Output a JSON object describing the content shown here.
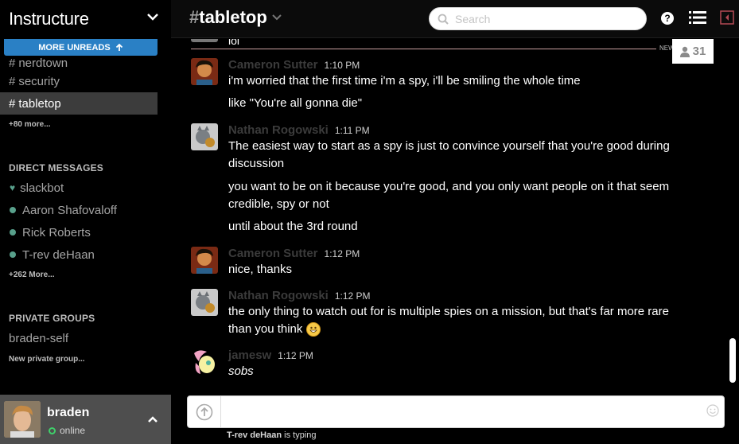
{
  "team": {
    "name": "Instructure"
  },
  "sidebar": {
    "more_unreads": "MORE UNREADS",
    "channels": [
      {
        "name": "nerdtown",
        "active": false,
        "clipped": true
      },
      {
        "name": "security",
        "active": false
      },
      {
        "name": "tabletop",
        "active": true
      }
    ],
    "channels_more": "+80 more...",
    "dm_heading": "DIRECT MESSAGES",
    "dms": [
      {
        "name": "slackbot",
        "icon": "heart-icon"
      },
      {
        "name": "Aaron Shafovaloff",
        "icon": "presence-dot"
      },
      {
        "name": "Rick Roberts",
        "icon": "presence-dot"
      },
      {
        "name": "T-rev deHaan",
        "icon": "presence-dot"
      }
    ],
    "dms_more": "+262 More...",
    "groups_heading": "PRIVATE GROUPS",
    "groups": [
      {
        "name": "braden-self"
      }
    ],
    "new_group": "New private group..."
  },
  "user": {
    "name": "braden",
    "status": "online"
  },
  "header": {
    "hash": "#",
    "channel": "tabletop",
    "search_placeholder": "Search"
  },
  "channel_info": {
    "member_count": "31",
    "new_messages_label": "NEW M"
  },
  "previous_message": {
    "text": "lol"
  },
  "messages": [
    {
      "author": "Cameron Sutter",
      "time": "1:10 PM",
      "avatar": "cameron",
      "lines": [
        "i'm worried that the first time i'm a spy, i'll be smiling the whole time",
        "like \"You're all gonna die\""
      ]
    },
    {
      "author": "Nathan Rogowski",
      "time": "1:11 PM",
      "avatar": "nathan",
      "lines": [
        "The easiest way to start as a spy is just to convince yourself that you're good during",
        "discussion",
        "you want to be on it because you're good, and you only want people on it that seem",
        "credible, spy or not",
        "until about the 3rd round"
      ]
    },
    {
      "author": "Cameron Sutter",
      "time": "1:12 PM",
      "avatar": "cameron",
      "lines": [
        "nice, thanks"
      ]
    },
    {
      "author": "Nathan Rogowski",
      "time": "1:12 PM",
      "avatar": "nathan",
      "lines": [
        "the only thing to watch out for is multiple spies on a mission, but that's far more rare",
        "than you think"
      ]
    },
    {
      "author": "jamesw",
      "time": "1:12 PM",
      "avatar": "jamesw",
      "lines": [
        "sobs"
      ]
    }
  ],
  "composer": {
    "placeholder": ""
  },
  "typing": {
    "who": "T-rev deHaan",
    "suffix": " is typing"
  },
  "colors": {
    "accent": "#2a80c5",
    "presence": "#58a08b",
    "online": "#3fcf6a"
  }
}
